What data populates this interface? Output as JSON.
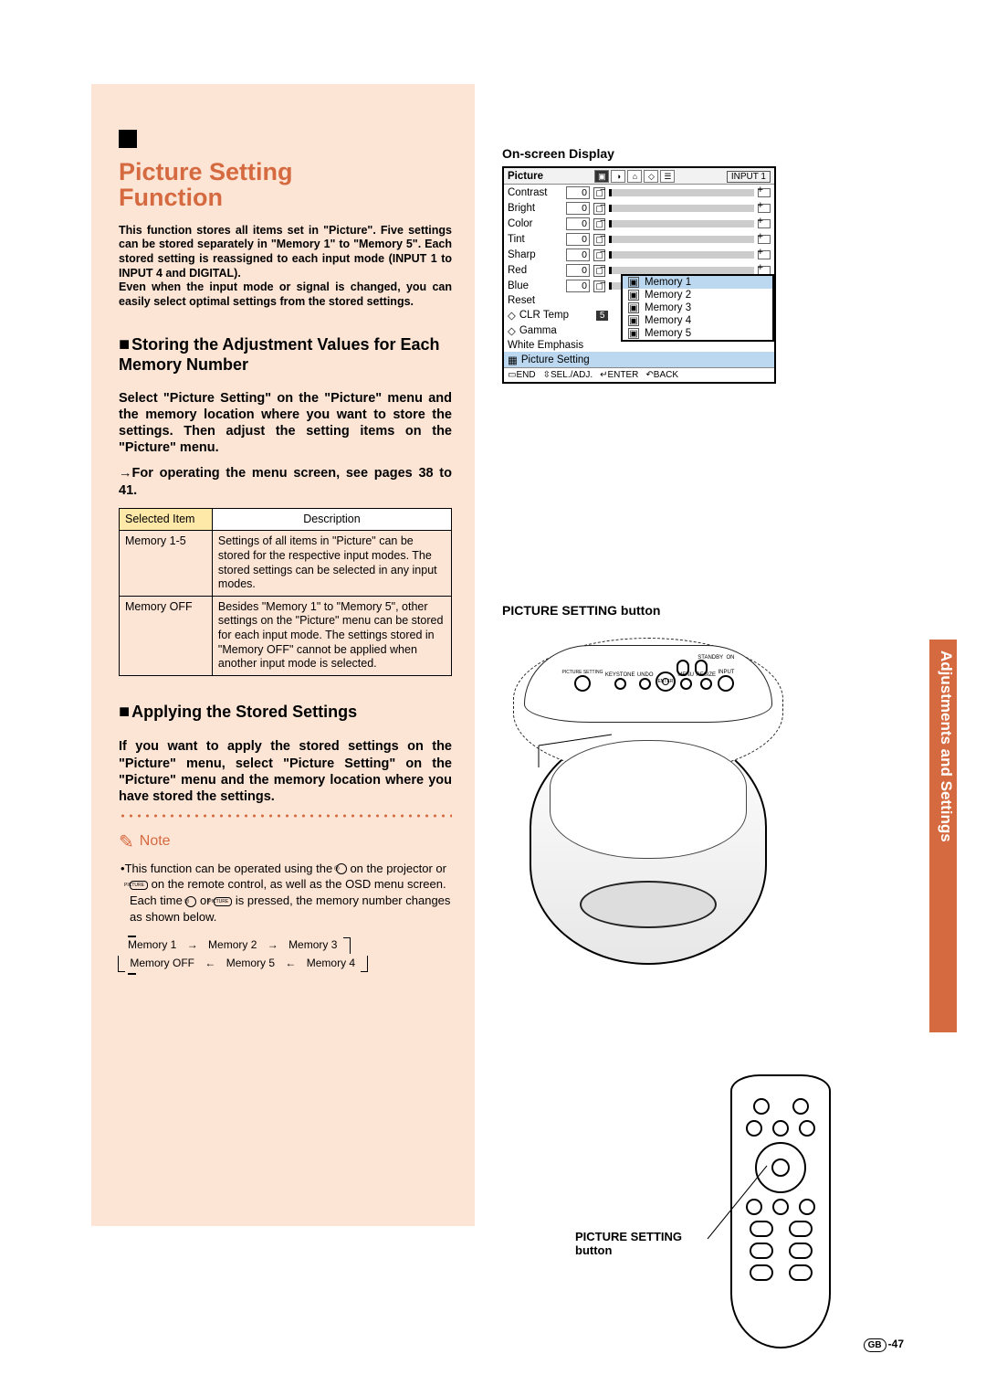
{
  "side_tab": "Adjustments and Settings",
  "main_title_l1": "Picture Setting",
  "main_title_l2": "Function",
  "intro": "This function stores all items set in \"Picture\". Five settings can be stored separately in \"Memory 1\" to \"Memory 5\". Each stored setting is reassigned to each input mode (INPUT 1 to INPUT 4 and DIGITAL).\nEven when the input mode or signal is changed, you can easily select optimal settings from the stored settings.",
  "h_storing": "Storing the Adjustment Values for Each Memory Number",
  "storing_body": "Select \"Picture Setting\" on the \"Picture\" menu and the memory location where you want to store the settings. Then adjust the setting items on the \"Picture\" menu.",
  "storing_ref": "→For operating the menu screen, see pages 38 to 41.",
  "table": {
    "h_sel": "Selected Item",
    "h_desc": "Description",
    "r1_sel": "Memory 1-5",
    "r1_desc": "Settings of all items in \"Picture\" can be stored for the respective input modes. The stored settings can be selected in any input modes.",
    "r2_sel": "Memory OFF",
    "r2_desc": "Besides \"Memory 1\" to \"Memory 5\", other settings on the \"Picture\" menu can be stored for each input mode. The settings stored in \"Memory OFF\" cannot be applied when another input mode is selected."
  },
  "h_applying": "Applying the Stored Settings",
  "applying_body": "If you want to apply the stored settings on the \"Picture\" menu, select \"Picture Setting\" on the \"Picture\" menu and the memory location where you have stored the settings.",
  "note_label": "Note",
  "note_body_1": "This function can be operated using the ",
  "note_body_2": " on the projector or ",
  "note_body_3": " on the remote control, as well as the OSD menu screen. Each time ",
  "note_body_4": " or ",
  "note_body_5": " is pressed, the memory number changes as shown below.",
  "cycle": [
    "Memory 1",
    "Memory 2",
    "Memory 3",
    "Memory OFF",
    "Memory 5",
    "Memory 4"
  ],
  "osd": {
    "label": "On-screen Display",
    "title": "Picture",
    "input": "INPUT 1",
    "rows": [
      {
        "name": "Contrast",
        "val": "0"
      },
      {
        "name": "Bright",
        "val": "0"
      },
      {
        "name": "Color",
        "val": "0"
      },
      {
        "name": "Tint",
        "val": "0"
      },
      {
        "name": "Sharp",
        "val": "0"
      },
      {
        "name": "Red",
        "val": "0"
      },
      {
        "name": "Blue",
        "val": "0"
      }
    ],
    "reset": "Reset",
    "clr": "CLR Temp",
    "clr_v": "5",
    "gamma": "Gamma",
    "white": "White Emphasis",
    "psetting": "Picture Setting",
    "memories": [
      "Memory 1",
      "Memory 2",
      "Memory 3",
      "Memory 4",
      "Memory 5"
    ],
    "foot": [
      "END",
      "SEL./ADJ.",
      "ENTER",
      "BACK"
    ]
  },
  "fig1_label": "PICTURE SETTING button",
  "panel_buttons": [
    "PICTURE SETTING",
    "KEYSTONE",
    "UNDO",
    "",
    "MENU",
    "RESIZE",
    "INPUT"
  ],
  "panel_top": [
    "STANDBY",
    "ON"
  ],
  "remote_label": "PICTURE SETTING button",
  "page_num_prefix": "GB",
  "page_num": "-47"
}
